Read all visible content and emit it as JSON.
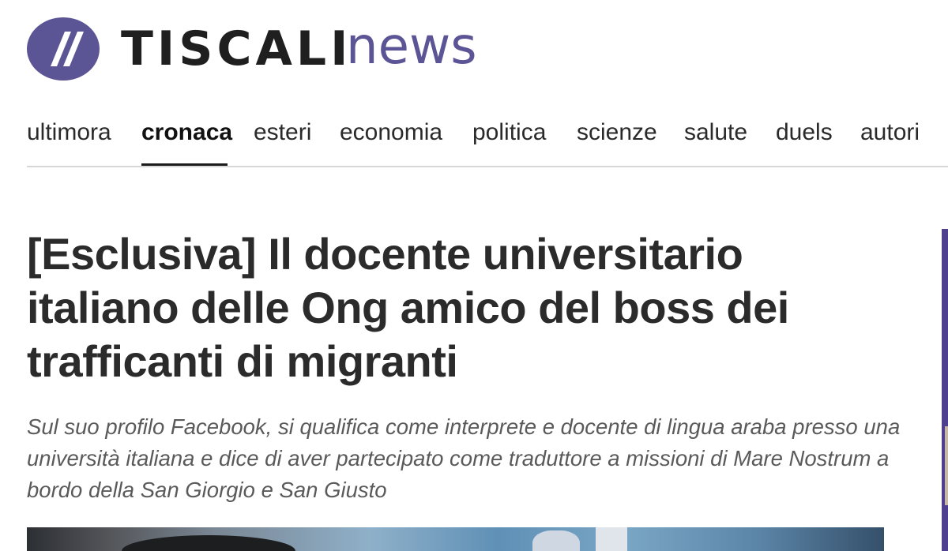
{
  "brand": {
    "name": "TISCALI",
    "section": "news",
    "accent_color": "#5b5596",
    "logo_icon": "double-slash-logo-icon"
  },
  "nav": {
    "items": [
      {
        "label": "ultimora",
        "active": false
      },
      {
        "label": "cronaca",
        "active": true
      },
      {
        "label": "esteri",
        "active": false
      },
      {
        "label": "economia",
        "active": false
      },
      {
        "label": "politica",
        "active": false
      },
      {
        "label": "scienze",
        "active": false
      },
      {
        "label": "salute",
        "active": false
      },
      {
        "label": "duels",
        "active": false
      },
      {
        "label": "autori",
        "active": false
      }
    ]
  },
  "article": {
    "headline": "[Esclusiva] Il docente universitario italiano delle Ong amico del boss dei trafficanti di migranti",
    "subtitle": "Sul suo profilo Facebook, si qualifica come interprete e docente di lingua araba presso una università italiana e dice di aver partecipato come traduttore a missioni di Mare Nostrum a bordo della San Giorgio e San Giusto"
  }
}
